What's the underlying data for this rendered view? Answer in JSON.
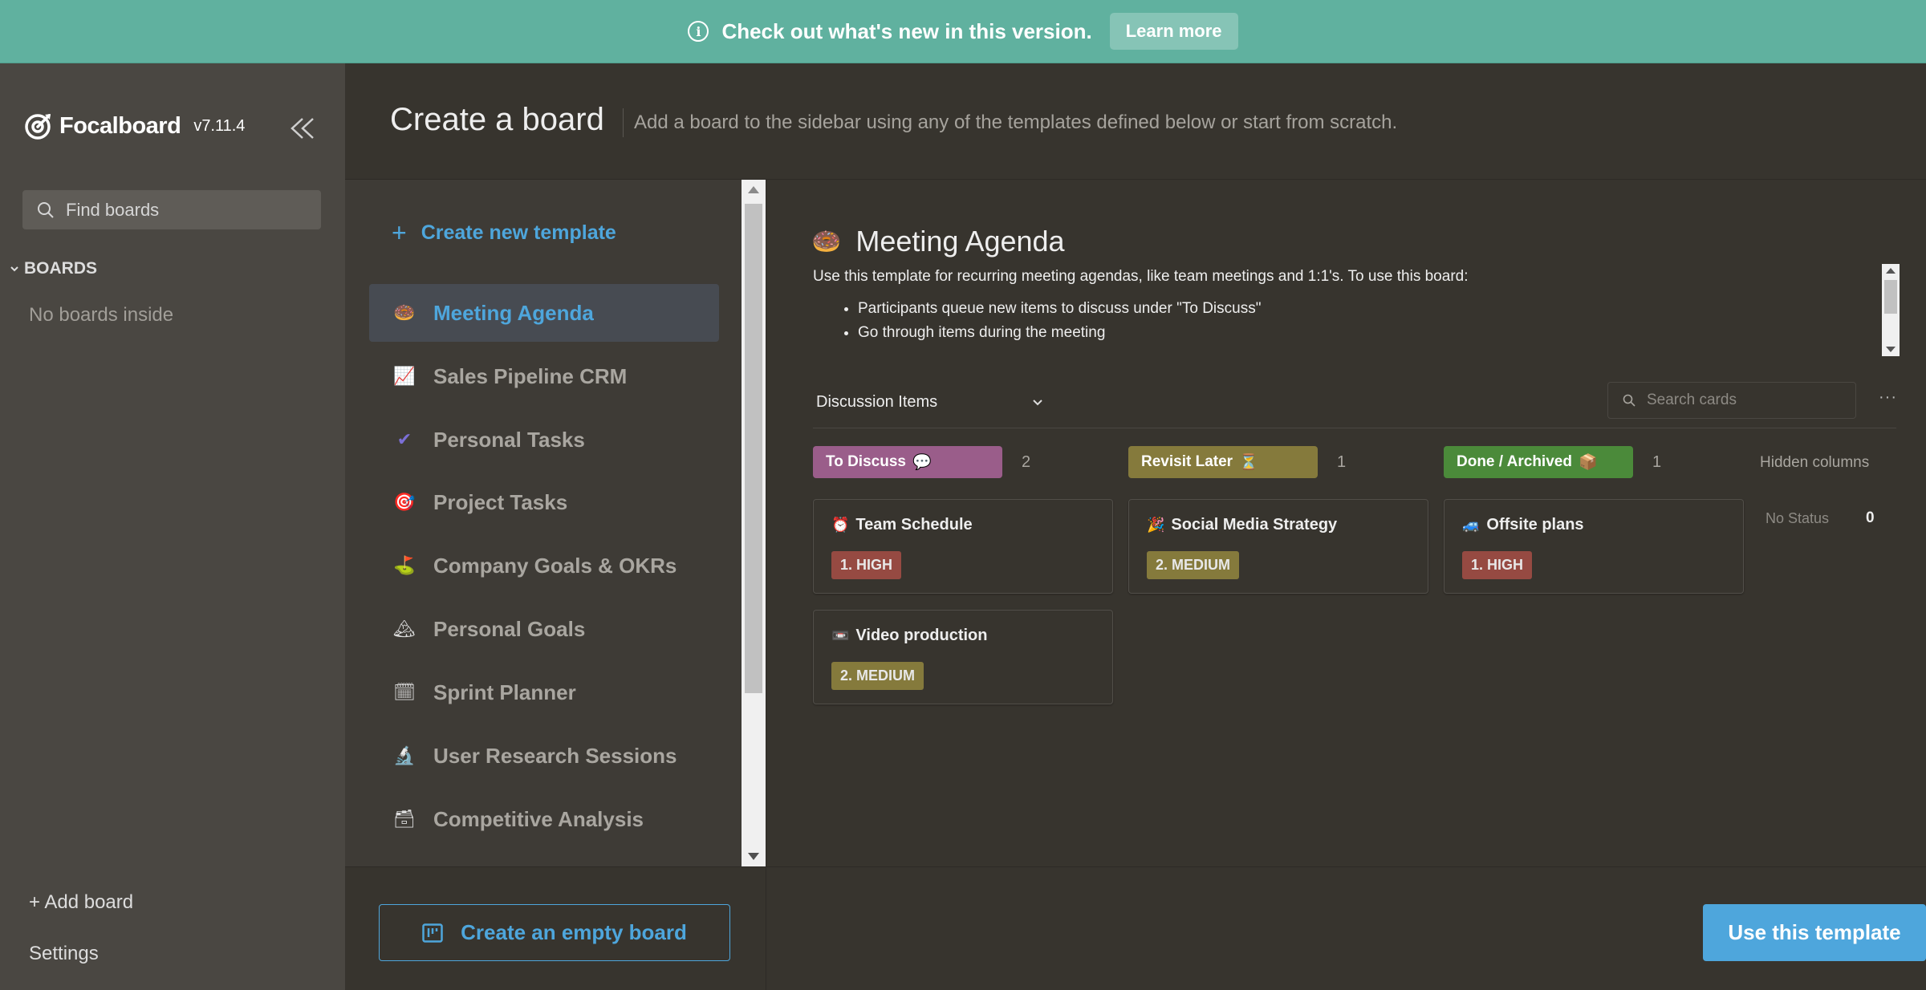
{
  "banner": {
    "message": "Check out what's new in this version.",
    "learn_more": "Learn more"
  },
  "sidebar": {
    "app_name": "Focalboard",
    "version": "v7.11.4",
    "search_placeholder": "Find boards",
    "section_label": "BOARDS",
    "empty_text": "No boards inside",
    "add_board": "+ Add board",
    "settings": "Settings"
  },
  "header": {
    "title": "Create a board",
    "subtitle": "Add a board to the sidebar using any of the templates defined below or start from scratch."
  },
  "templates": {
    "create_new": "Create new template",
    "items": [
      {
        "icon": "🍩",
        "label": "Meeting Agenda"
      },
      {
        "icon": "📈",
        "label": "Sales Pipeline CRM"
      },
      {
        "icon": "✔",
        "label": "Personal Tasks"
      },
      {
        "icon": "🎯",
        "label": "Project Tasks"
      },
      {
        "icon": "⛳",
        "label": "Company Goals & OKRs"
      },
      {
        "icon": "🏔",
        "label": "Personal Goals"
      },
      {
        "icon": "🗓",
        "label": "Sprint Planner"
      },
      {
        "icon": "🔬",
        "label": "User Research Sessions"
      },
      {
        "icon": "🗃",
        "label": "Competitive Analysis"
      }
    ],
    "empty_board": "Create an empty board"
  },
  "preview": {
    "icon": "🍩",
    "title": "Meeting Agenda",
    "description": "Use this template for recurring meeting agendas, like team meetings and 1:1's. To use this board:",
    "bullets": [
      "Participants queue new items to discuss under \"To Discuss\"",
      "Go through items during the meeting"
    ],
    "view_name": "Discussion Items",
    "search_placeholder": "Search cards",
    "more": "···",
    "columns": [
      {
        "label": "To Discuss",
        "icon": "💬",
        "count": "2",
        "color": "#9a5d8a"
      },
      {
        "label": "Revisit Later",
        "icon": "⏳",
        "count": "1",
        "color": "#857a3c"
      },
      {
        "label": "Done / Archived",
        "icon": "📦",
        "count": "1",
        "color": "#4b8a3a"
      }
    ],
    "hidden_columns": "Hidden columns",
    "no_status": "No Status",
    "no_status_count": "0",
    "cards": [
      {
        "icon": "⏰",
        "title": "Team Schedule",
        "badge": "1. HIGH",
        "badge_color": "#964a42"
      },
      {
        "icon": "🎉",
        "title": "Social Media Strategy",
        "badge": "2. MEDIUM",
        "badge_color": "#857a3c"
      },
      {
        "icon": "🚙",
        "title": "Offsite plans",
        "badge": "1. HIGH",
        "badge_color": "#964a42"
      },
      {
        "icon": "📼",
        "title": "Video production",
        "badge": "2. MEDIUM",
        "badge_color": "#857a3c"
      }
    ],
    "use_template": "Use this template"
  }
}
